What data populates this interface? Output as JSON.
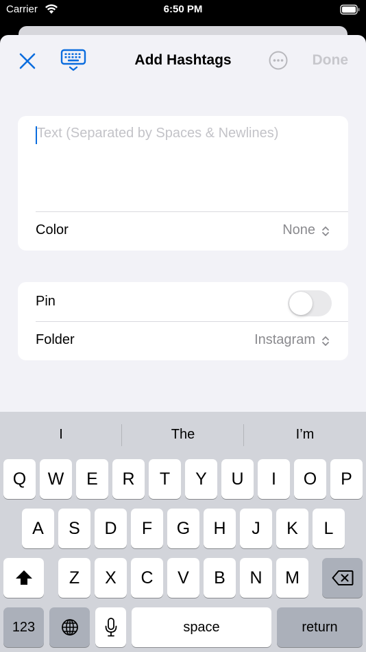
{
  "status_bar": {
    "carrier": "Carrier",
    "time": "6:50 PM"
  },
  "nav": {
    "title": "Add Hashtags",
    "done_label": "Done"
  },
  "form": {
    "text_placeholder": "Text (Separated by Spaces & Newlines)",
    "color_label": "Color",
    "color_value": "None",
    "pin_label": "Pin",
    "pin_on": false,
    "folder_label": "Folder",
    "folder_value": "Instagram"
  },
  "keyboard": {
    "suggestions": [
      "I",
      "The",
      "I’m"
    ],
    "row1": [
      "Q",
      "W",
      "E",
      "R",
      "T",
      "Y",
      "U",
      "I",
      "O",
      "P"
    ],
    "row2": [
      "A",
      "S",
      "D",
      "F",
      "G",
      "H",
      "J",
      "K",
      "L"
    ],
    "row3": [
      "Z",
      "X",
      "C",
      "V",
      "B",
      "N",
      "M"
    ],
    "numbers_label": "123",
    "space_label": "space",
    "return_label": "return"
  },
  "colors": {
    "accent": "#0a6cde",
    "done_disabled": "#c7c7cc",
    "background": "#f2f2f7",
    "keyboard_bg": "#d2d4da"
  }
}
